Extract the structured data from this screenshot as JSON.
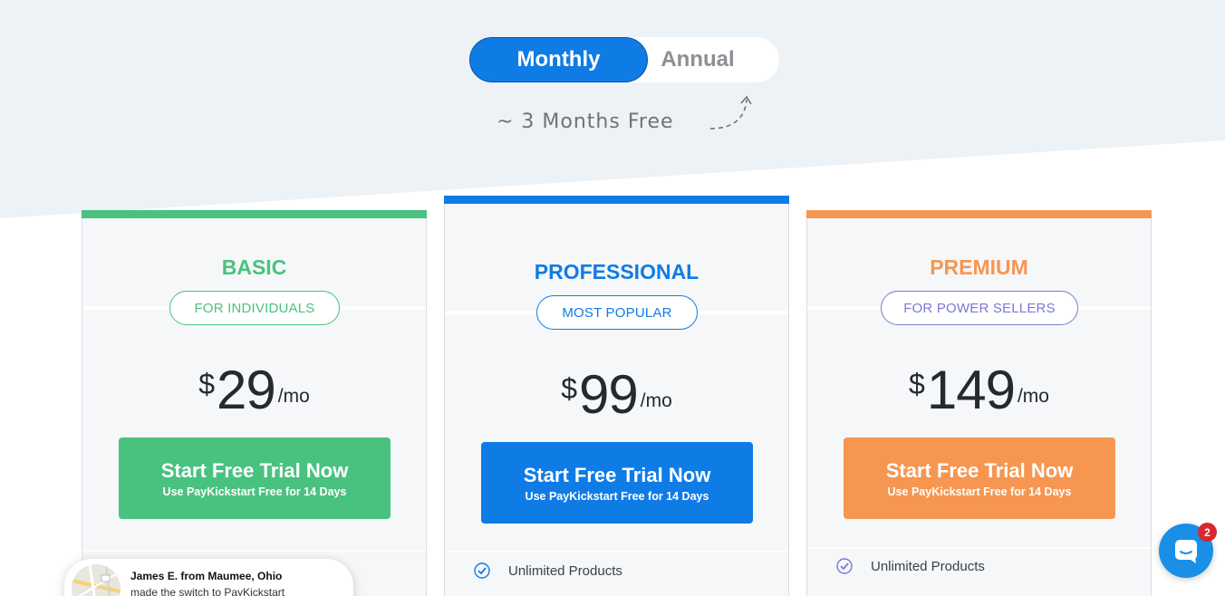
{
  "billing_toggle": {
    "monthly_label": "Monthly",
    "annual_label": "Annual",
    "selected": "Monthly",
    "promo": "~ 3 Months Free"
  },
  "colors": {
    "background_top": "#edf2f6",
    "basic": "#49c27f",
    "professional": "#0f7ce6",
    "premium": "#f79650",
    "premium_pill": "#7b78d6"
  },
  "plans": [
    {
      "name": "BASIC",
      "tag": "FOR INDIVIDUALS",
      "currency": "$",
      "price": "29",
      "period": "/mo",
      "cta_main": "Start Free Trial Now",
      "cta_sub": "Use PayKickstart Free for 14 Days"
    },
    {
      "name": "PROFESSIONAL",
      "tag": "MOST POPULAR",
      "currency": "$",
      "price": "99",
      "period": "/mo",
      "cta_main": "Start Free Trial Now",
      "cta_sub": "Use PayKickstart Free for 14 Days",
      "features": [
        "Unlimited Products"
      ]
    },
    {
      "name": "PREMIUM",
      "tag": "FOR POWER SELLERS",
      "currency": "$",
      "price": "149",
      "period": "/mo",
      "cta_main": "Start Free Trial Now",
      "cta_sub": "Use PayKickstart Free for 14 Days",
      "features": [
        "Unlimited Products"
      ]
    }
  ],
  "toast": {
    "name": "James E. from Maumee, Ohio",
    "message": "made the switch to PayKickstart"
  },
  "chat": {
    "badge_count": "2",
    "icon": "chat-bubble-icon"
  }
}
